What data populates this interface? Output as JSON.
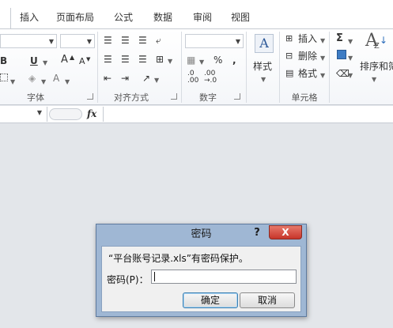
{
  "tabs": [
    {
      "label": "插入",
      "active": true
    },
    {
      "label": "页面布局",
      "active": false
    },
    {
      "label": "公式",
      "active": false
    },
    {
      "label": "数据",
      "active": false
    },
    {
      "label": "审阅",
      "active": false
    },
    {
      "label": "视图",
      "active": false
    }
  ],
  "ribbon": {
    "font_group": {
      "label": "字体",
      "bold": "B",
      "underline": "U",
      "grow_font": "A",
      "shrink_font": "A",
      "font_color": "A"
    },
    "alignment_group": {
      "label": "对齐方式"
    },
    "number_group": {
      "label": "数字",
      "percent": "%",
      "comma": ",",
      "increase_decimal": "←.0\n.00",
      "inc_top": ".0",
      "inc_bottom": ".00",
      "dec_top": ".00",
      "dec_bottom": "→.0"
    },
    "styles_group": {
      "label": "样式"
    },
    "cells_group": {
      "label": "单元格",
      "insert": "插入",
      "delete": "删除",
      "format": "格式"
    },
    "editing_group": {
      "sigma": "Σ",
      "sort_filter": "排序和筛"
    }
  },
  "formula_bar": {
    "fx": "fx"
  },
  "dialog": {
    "title": "密码",
    "help": "?",
    "close": "X",
    "message": "“平台账号记录.xls”有密码保护。",
    "password_label": "密码(P)：",
    "ok": "确定",
    "cancel": "取消"
  },
  "colors": {
    "close_button": "#c7352a",
    "dialog_frame": "#9fb7d4",
    "workspace": "#e3e6ea"
  }
}
